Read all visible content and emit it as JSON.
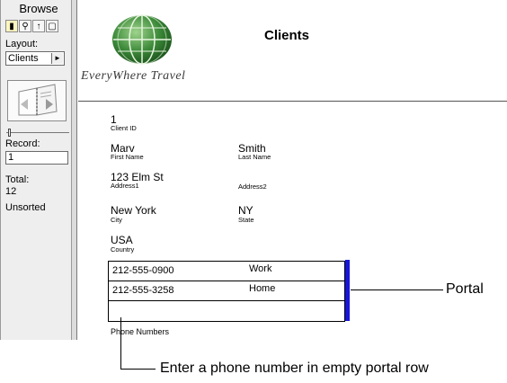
{
  "status_area": {
    "mode": "Browse",
    "tools": [
      "browse-tool",
      "find-tool",
      "layout-tool",
      "preview-tool"
    ],
    "layout_label": "Layout:",
    "layout_value": "Clients",
    "record_label": "Record:",
    "record_value": "1",
    "total_label": "Total:",
    "total_value": "12",
    "sort_status": "Unsorted"
  },
  "header": {
    "brand": "EveryWhere Travel",
    "title": "Clients"
  },
  "record": {
    "client_id": {
      "value": "1",
      "label": "Client ID"
    },
    "first_name": {
      "value": "Marv",
      "label": "First Name"
    },
    "last_name": {
      "value": "Smith",
      "label": "Last Name"
    },
    "address1": {
      "value": "123 Elm St",
      "label": "Address1"
    },
    "address2": {
      "value": "",
      "label": "Address2"
    },
    "city": {
      "value": "New York",
      "label": "City"
    },
    "state": {
      "value": "NY",
      "label": "State"
    },
    "country": {
      "value": "USA",
      "label": "Country"
    }
  },
  "portal": {
    "rows": [
      {
        "number": "212-555-0900",
        "type": "Work"
      },
      {
        "number": "212-555-3258",
        "type": "Home"
      },
      {
        "number": "",
        "type": ""
      }
    ],
    "label": "Phone Numbers"
  },
  "callouts": {
    "portal": "Portal",
    "empty_row": "Enter a phone number in empty portal row"
  },
  "colors": {
    "portal_marker": "#1717d8",
    "globe_green": "#3d8a3a"
  }
}
